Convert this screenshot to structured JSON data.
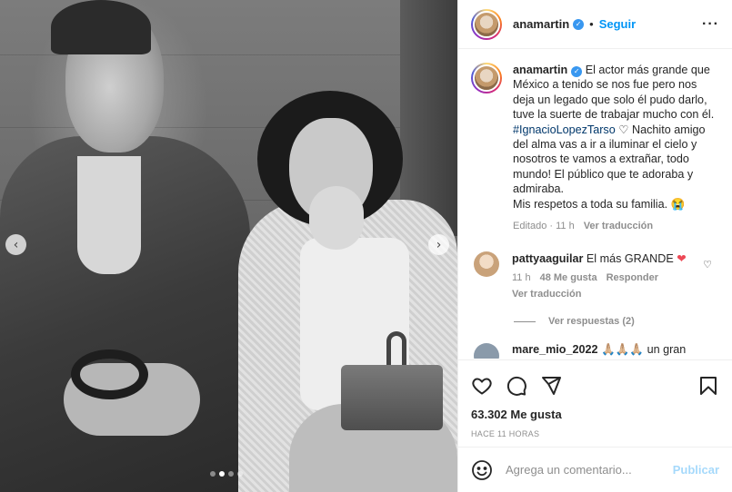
{
  "post": {
    "author": "anamartin",
    "follow_label": "Seguir",
    "separator": "•",
    "more_label": "···"
  },
  "photo": {
    "prev_label": "‹",
    "next_label": "›",
    "slide_count": 4,
    "active_slide": 1
  },
  "caption": {
    "author": "anamartin",
    "text_before": "El actor más grande que México a tenido se nos fue pero nos deja un legado que solo él pudo darlo, tuve la suerte de trabajar mucho con él. ",
    "hashtag": "#IgnacioLopezTarso",
    "text_after": " ♡ Nachito amigo del alma vas a ir a iluminar el cielo y nosotros te vamos a extrañar, todo mundo! El público que te adoraba y admiraba.",
    "line_last": "Mis respetos a toda su familia. 😭",
    "edited": "Editado",
    "dot": "·",
    "age": "11 h",
    "translate": "Ver traducción"
  },
  "comments": [
    {
      "user": "pattyaaguilar",
      "text": "El más GRANDE",
      "heart": "❤",
      "age": "11 h",
      "likes": "48 Me gusta",
      "reply": "Responder",
      "translate": "Ver traducción",
      "view_replies": "Ver respuestas (2)"
    },
    {
      "user": "mare_mio_2022",
      "text": "🙏🏼🙏🏼🙏🏼 un gran"
    }
  ],
  "stats": {
    "likes": "63.302 Me gusta",
    "time": "HACE 11 HORAS"
  },
  "composer": {
    "placeholder": "Agrega un comentario...",
    "publish_label": "Publicar"
  },
  "colors": {
    "accent": "#0095f6",
    "verified": "#3897f0",
    "heart": "#ed4956",
    "hashtag": "#00376b",
    "muted": "#8e8e8e"
  }
}
